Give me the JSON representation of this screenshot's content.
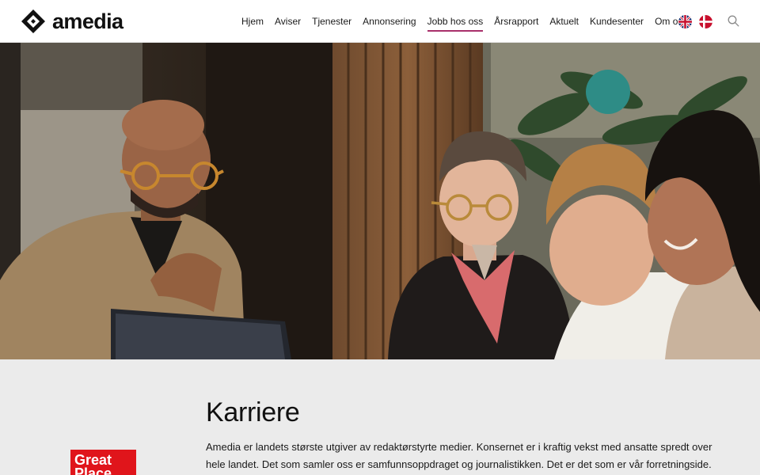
{
  "brand": {
    "name": "amedia",
    "accent_color": "#a8306b"
  },
  "nav": {
    "items": [
      {
        "label": "Hjem"
      },
      {
        "label": "Aviser"
      },
      {
        "label": "Tjenester"
      },
      {
        "label": "Annonsering"
      },
      {
        "label": "Jobb hos oss",
        "active": true
      },
      {
        "label": "Årsrapport"
      },
      {
        "label": "Aktuelt"
      },
      {
        "label": "Kundesenter"
      },
      {
        "label": "Om oss"
      }
    ]
  },
  "language": {
    "options": [
      "english-flag-icon",
      "danish-flag-icon"
    ]
  },
  "search": {
    "icon": "search-icon"
  },
  "hero": {
    "icon": "photo-of-four-colleagues-at-laptop"
  },
  "main": {
    "title": "Karriere",
    "intro": "Amedia er landets største utgiver av redaktørstyrte medier. Konsernet er i kraftig vekst med ansatte spredt over hele landet. Det som samler oss er samfunnsoppdraget og journalistikken. Det er det som er vår forretningside.",
    "badge": {
      "line1": "Great",
      "line2": "Place",
      "color": "#e0151b"
    }
  }
}
